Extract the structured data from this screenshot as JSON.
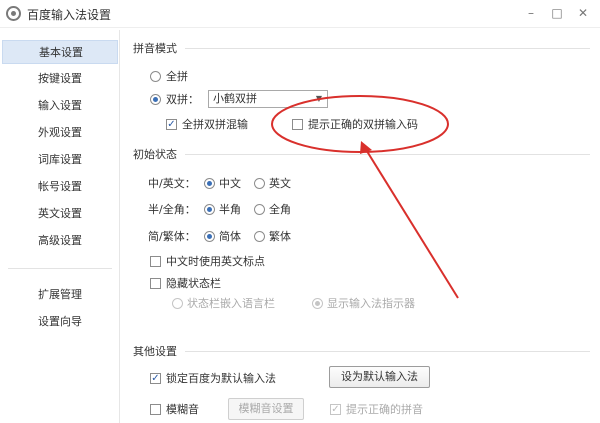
{
  "window": {
    "title": "百度输入法设置",
    "minimize": "–",
    "maximize": "□",
    "close": "✕"
  },
  "sidebar": {
    "items": [
      {
        "label": "基本设置",
        "active": true
      },
      {
        "label": "按键设置"
      },
      {
        "label": "输入设置"
      },
      {
        "label": "外观设置"
      },
      {
        "label": "词库设置"
      },
      {
        "label": "帐号设置"
      },
      {
        "label": "英文设置"
      },
      {
        "label": "高级设置"
      }
    ],
    "bottom_items": [
      {
        "label": "扩展管理"
      },
      {
        "label": "设置向导"
      }
    ]
  },
  "pinyin_mode": {
    "title": "拼音模式",
    "full_pinyin": "全拼",
    "double_pinyin": "双拼：",
    "scheme_value": "小鹤双拼",
    "mixed_input": "全拼双拼混输",
    "show_correct_code": "提示正确的双拼输入码"
  },
  "initial_state": {
    "title": "初始状态",
    "cn_en_label": "中/英文：",
    "cn": "中文",
    "en": "英文",
    "width_label": "半/全角：",
    "half": "半角",
    "full": "全角",
    "script_label": "简/繁体：",
    "simplified": "简体",
    "traditional": "繁体",
    "cn_en_punct": "中文时使用英文标点",
    "hide_status_bar": "隐藏状态栏",
    "embed_language_bar": "状态栏嵌入语言栏",
    "show_indicator": "显示输入法指示器"
  },
  "other_settings": {
    "title": "其他设置",
    "lock_default": "锁定百度为默认输入法",
    "set_default_button": "设为默认输入法",
    "fuzzy": "模糊音",
    "fuzzy_settings_button": "模糊音设置",
    "show_correct_pinyin": "提示正确的拼音"
  },
  "colors": {
    "accent": "#3b6fb6",
    "annotation": "#d9302c",
    "sidebar_active": "#dde8f6"
  }
}
